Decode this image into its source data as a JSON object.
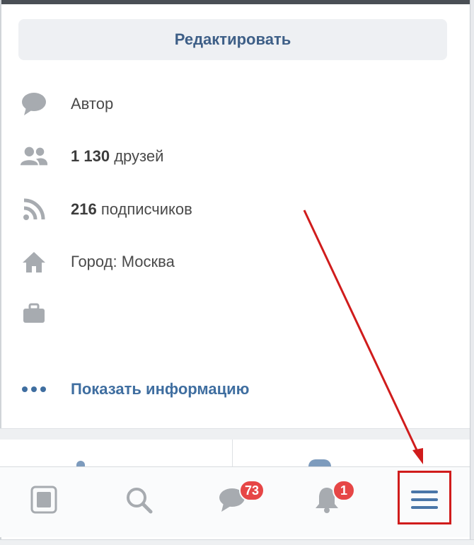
{
  "profile": {
    "edit_button": "Редактировать",
    "info": {
      "status": "Автор",
      "friends_count": "1 130",
      "friends_label": "друзей",
      "followers_count": "216",
      "followers_label": "подписчиков",
      "city": "Город: Москва",
      "work": ""
    },
    "show_info": "Показать информацию"
  },
  "tabbar": {
    "messages_badge": "73",
    "notifications_badge": "1"
  },
  "colors": {
    "accent": "#3f6ea0",
    "button_text": "#3e5f87",
    "icon_grey": "#a7abb0",
    "badge": "#e64646",
    "annotation": "#d01c1c"
  },
  "icons": {
    "status": "speech-bubble-icon",
    "friends": "people-icon",
    "followers": "rss-feed-icon",
    "city": "home-icon",
    "work": "briefcase-icon",
    "more": "dots-icon",
    "tabs": [
      "news-icon",
      "search-icon",
      "messages-icon",
      "bell-icon",
      "menu-icon"
    ]
  }
}
